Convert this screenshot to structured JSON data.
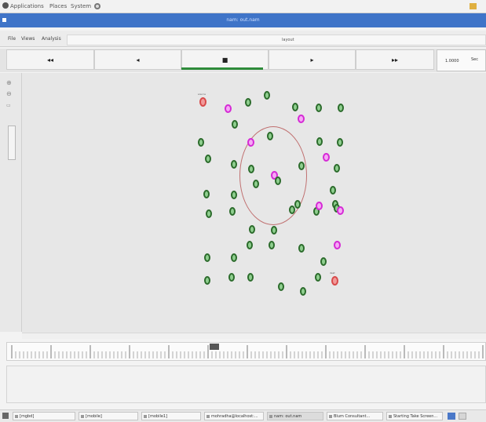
{
  "top_panel": {
    "menus": [
      "Applications",
      "Places",
      "System"
    ]
  },
  "window": {
    "title": "nam: out.nam"
  },
  "menu_bar": {
    "items": [
      "File",
      "Views",
      "Analysis"
    ],
    "info_text": "layout"
  },
  "transport": {
    "rewind": "◂◂",
    "back": "◂",
    "stop": "■",
    "play": "▸",
    "fast_forward": "▸▸",
    "time_value": "1.0000",
    "time_unit": "Sec"
  },
  "nodes": {
    "labels": {
      "source": "source",
      "dest": "dest"
    }
  },
  "taskbar": {
    "items": [
      "[mgbd]",
      "[mobile]",
      "[mobile1]",
      "mohradha@localhost:...",
      "nam: out.nam",
      "Blum Consultant...",
      "Starting Take Screen..."
    ]
  },
  "colors": {
    "title_bar": "#3f74c8",
    "node_green": "#2b6b2b",
    "node_magenta": "#d52ad5",
    "node_red": "#d84a4a",
    "stop_underline": "#2e8b3a",
    "range_circle": "#c07070"
  }
}
